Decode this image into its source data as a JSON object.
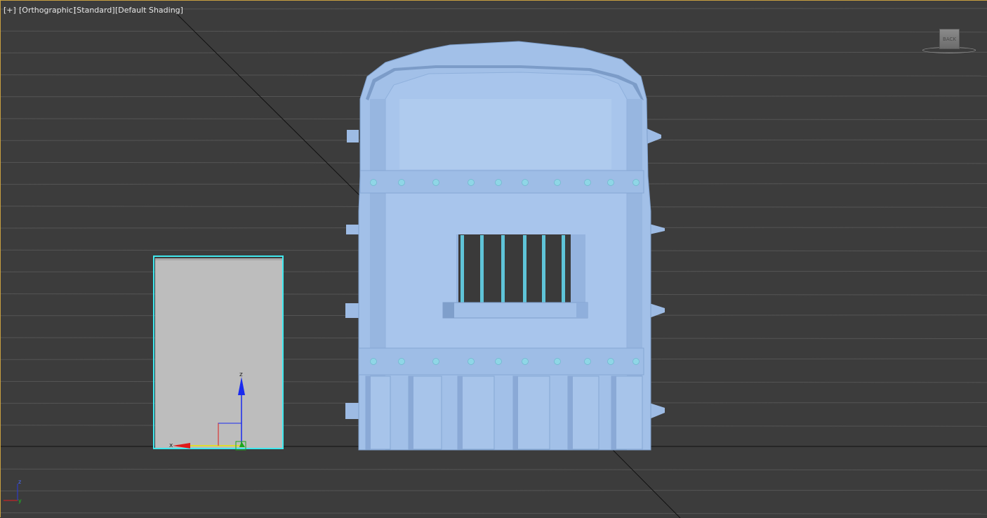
{
  "viewport": {
    "label_plus": "[+]",
    "label_view": "[Orthographic]",
    "label_standard": "[Standard]",
    "label_shading": "[Default Shading]"
  },
  "viewcube": {
    "face_label": "BACK"
  },
  "gizmo": {
    "z_label": "z",
    "x_label": "x"
  },
  "axis_tripod": {
    "z_label": "z",
    "y_label": "y"
  },
  "colors": {
    "viewport_bg": "#3c3c3c",
    "grid_line": "#555555",
    "grid_axis": "#111111",
    "door_fill": "#a2c0e8",
    "door_shade": "#90b0db",
    "door_light": "#b4cff0",
    "rivet": "#8fd6e6",
    "bar": "#5fc4d8",
    "selected_box_fill": "#bdbdbd",
    "selection_outline": "#40e8ee",
    "gizmo_z": "#1a2aee",
    "gizmo_x": "#e01a1a",
    "gizmo_y": "#e8e800",
    "gizmo_green": "#1aa81a",
    "active_border": "#c8a040"
  }
}
